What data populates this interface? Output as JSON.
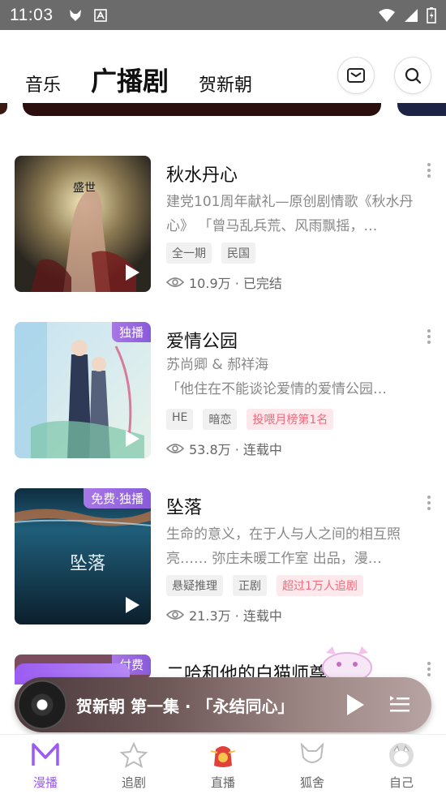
{
  "status_bar": {
    "time": "11:03"
  },
  "header": {
    "tabs": [
      {
        "label": "音乐"
      },
      {
        "label": "广播剧"
      },
      {
        "label": "贺新朝"
      }
    ]
  },
  "items": [
    {
      "title": "秋水丹心",
      "desc": "建党101周年献礼—原创剧情歌《秋水丹心》 「曾马乱兵荒、风雨飘摇，…",
      "tags": [
        "全一期",
        "民国"
      ],
      "stats": "10.9万 · 已完结",
      "cover_text": "盛世"
    },
    {
      "title": "爱情公园",
      "badge": "独播",
      "author": "苏尚卿 & 郝祥海",
      "desc": "「他住在不能谈论爱情的爱情公园…",
      "tags": [
        "HE",
        "暗恋"
      ],
      "hot_tag": "投喂月榜第1名",
      "stats": "53.8万 · 连载中"
    },
    {
      "title": "坠落",
      "badge": "免费·独播",
      "desc": "生命的意义，在于人与人之间的相互照亮…… 弥庄未暖工作室 出品，漫…",
      "tags": [
        "悬疑推理",
        "正剧"
      ],
      "hot_tag": "超过1万人追剧",
      "stats": "21.3万 · 连载中",
      "cover_text": "坠落"
    },
    {
      "title": "二哈和他的白猫师尊",
      "badge": "付费"
    }
  ],
  "player": {
    "title": "贺新朝 第一集 · 「永结同心」"
  },
  "bottom_nav": [
    {
      "label": "漫播",
      "active": true
    },
    {
      "label": "追剧"
    },
    {
      "label": "直播"
    },
    {
      "label": "狐舍"
    },
    {
      "label": "自己"
    }
  ],
  "colors": {
    "accent": "#9b5cf2",
    "hot_tag": "#f06b7c"
  }
}
